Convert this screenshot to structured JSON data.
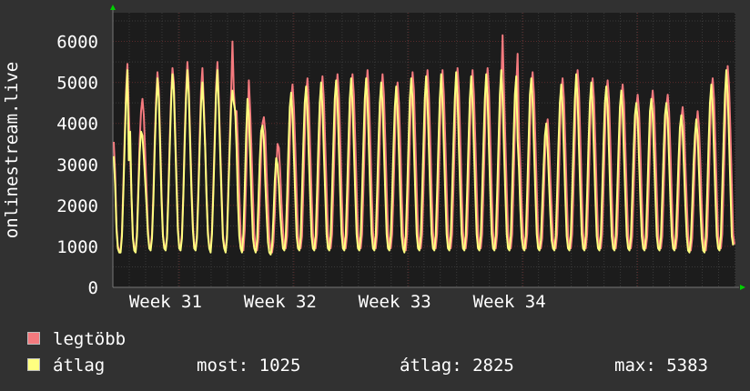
{
  "chart_data": {
    "type": "line",
    "ylabel": "onlinestream.live",
    "ylim": [
      0,
      6700
    ],
    "yticks": [
      0,
      1000,
      2000,
      3000,
      4000,
      5000,
      6000
    ],
    "xlabels": [
      "Week 31",
      "Week 32",
      "Week 33",
      "Week 34"
    ],
    "grid": true,
    "points_per_day": 12,
    "series": [
      {
        "name": "legtöbb",
        "color": "#f47a7e",
        "daily_peaks": [
          5450,
          4600,
          5250,
          5350,
          5500,
          5350,
          5500,
          6000,
          5050,
          4150,
          3500,
          4950,
          5100,
          5150,
          5200,
          5200,
          5300,
          5200,
          5000,
          5250,
          5300,
          5300,
          5350,
          5300,
          5350,
          6150,
          5700,
          5250,
          4100,
          5100,
          5300,
          5100,
          5050,
          4950,
          4700,
          4800,
          4700,
          4400,
          4300,
          5100,
          5400,
          3500
        ],
        "values": [
          3550,
          2800,
          1500,
          1000,
          900,
          900,
          1350,
          2500,
          3700,
          4800,
          5450,
          4300,
          3300,
          2200,
          1250,
          950,
          900,
          1350,
          2500,
          3600,
          4300,
          4600,
          4200,
          3300,
          2400,
          1450,
          1000,
          950,
          1300,
          2300,
          3600,
          4600,
          5250,
          4800,
          3600,
          2300,
          1300,
          1000,
          950,
          1250,
          2400,
          3600,
          4700,
          5350,
          5000,
          3800,
          2700,
          1500,
          1000,
          950,
          1300,
          2300,
          3700,
          4800,
          5500,
          4900,
          3700,
          2500,
          1550,
          1000,
          950,
          1300,
          2400,
          3700,
          4800,
          5350,
          4500,
          3500,
          2300,
          1400,
          1000,
          900,
          1400,
          2500,
          3700,
          4900,
          5500,
          4600,
          3500,
          2400,
          1300,
          1000,
          900,
          1300,
          2500,
          3600,
          4700,
          6000,
          4800,
          4200,
          4300,
          3500,
          2300,
          1300,
          1000,
          900,
          1400,
          2600,
          3900,
          5050,
          4300,
          3300,
          2200,
          1300,
          1000,
          900,
          1200,
          2200,
          3300,
          4000,
          4150,
          3800,
          2800,
          2000,
          1200,
          950,
          850,
          1100,
          1800,
          2800,
          3500,
          3400,
          2800,
          2000,
          1400,
          1000,
          950,
          1250,
          2300,
          3500,
          4600,
          4950,
          4400,
          3400,
          2300,
          1300,
          1000,
          950,
          1250,
          2400,
          3600,
          4700,
          5100,
          4500,
          3400,
          2300,
          1300,
          1000,
          950,
          1300,
          2400,
          3600,
          4700,
          5150,
          4600,
          3500,
          2400,
          1350,
          1000,
          950,
          1300,
          2400,
          3600,
          4700,
          5200,
          4700,
          3600,
          2400,
          1350,
          1000,
          950,
          1300,
          2400,
          3600,
          4800,
          5200,
          4700,
          3600,
          2400,
          1350,
          1000,
          950,
          1300,
          2400,
          3600,
          4800,
          5300,
          4700,
          3600,
          2400,
          1350,
          1000,
          950,
          1300,
          2400,
          3600,
          4700,
          5200,
          4700,
          3600,
          2400,
          1350,
          1000,
          950,
          1300,
          2300,
          3500,
          4600,
          5000,
          4500,
          3500,
          2300,
          1300,
          1000,
          900,
          1300,
          2400,
          3600,
          4700,
          5250,
          4800,
          3600,
          2400,
          1350,
          1000,
          950,
          1300,
          2400,
          3600,
          4800,
          5300,
          4700,
          3600,
          2400,
          1350,
          1000,
          950,
          1300,
          2400,
          3600,
          4800,
          5300,
          4700,
          3600,
          2400,
          1350,
          1000,
          950,
          1300,
          2400,
          3600,
          4800,
          5350,
          4800,
          3600,
          2400,
          1350,
          1000,
          950,
          1300,
          2400,
          3600,
          4800,
          5300,
          4700,
          3600,
          2400,
          1350,
          1000,
          950,
          1300,
          2400,
          3600,
          4800,
          5350,
          4800,
          3600,
          2400,
          1350,
          1000,
          950,
          1300,
          2400,
          3700,
          4900,
          6150,
          4800,
          3600,
          2400,
          1350,
          1000,
          950,
          1300,
          2500,
          3800,
          4900,
          5700,
          3800,
          3000,
          2000,
          1300,
          1000,
          950,
          1300,
          2400,
          3700,
          4900,
          5250,
          4700,
          3600,
          2400,
          1350,
          1000,
          950,
          1200,
          2100,
          3100,
          3800,
          4100,
          3600,
          2700,
          1900,
          1200,
          1000,
          950,
          1300,
          2400,
          3600,
          4700,
          5100,
          4600,
          3500,
          2300,
          1300,
          1000,
          950,
          1300,
          2400,
          3600,
          4800,
          5300,
          4800,
          3600,
          2400,
          1350,
          1000,
          950,
          1300,
          2400,
          3600,
          4700,
          5100,
          4600,
          3500,
          2300,
          1300,
          1000,
          950,
          1300,
          2400,
          3600,
          4700,
          5050,
          4600,
          3500,
          2300,
          1300,
          1000,
          950,
          1300,
          2400,
          3600,
          4600,
          4950,
          4500,
          3400,
          2300,
          1300,
          1000,
          950,
          1250,
          2300,
          3400,
          4400,
          4700,
          4300,
          3300,
          2200,
          1300,
          1000,
          950,
          1250,
          2300,
          3400,
          4400,
          4800,
          4400,
          3400,
          2300,
          1300,
          1000,
          950,
          1250,
          2300,
          3400,
          4400,
          4700,
          4300,
          3300,
          2200,
          1300,
          1000,
          950,
          1250,
          2200,
          3300,
          4100,
          4400,
          4000,
          3000,
          2100,
          1300,
          950,
          900,
          1200,
          2100,
          3100,
          3900,
          4300,
          3900,
          3000,
          2000,
          1250,
          950,
          900,
          1250,
          2400,
          3600,
          4700,
          5100,
          4600,
          3500,
          2300,
          1300,
          1000,
          950,
          1300,
          2500,
          3700,
          4800,
          5400,
          4900,
          3800,
          2500,
          1300,
          1050
        ]
      },
      {
        "name": "átlag",
        "color": "#ffff80",
        "daily_peaks": [
          5300,
          3800,
          5100,
          5200,
          5300,
          5000,
          5300,
          4800,
          4600,
          3950,
          3150,
          4750,
          4900,
          5000,
          5050,
          5100,
          5100,
          5000,
          4900,
          5100,
          5150,
          5200,
          5250,
          5150,
          5200,
          5300,
          5150,
          5100,
          4000,
          4950,
          5200,
          5000,
          4900,
          4800,
          4500,
          4600,
          4500,
          4200,
          4100,
          4950,
          5300,
          3300
        ],
        "values": [
          3200,
          2500,
          1400,
          950,
          850,
          850,
          1250,
          2300,
          3500,
          4600,
          5300,
          3100,
          3800,
          2200,
          1200,
          900,
          850,
          1250,
          2300,
          3300,
          3800,
          3700,
          3200,
          2600,
          2000,
          1300,
          950,
          900,
          1200,
          2100,
          3400,
          4400,
          5100,
          4600,
          3400,
          2100,
          1250,
          950,
          900,
          1200,
          2200,
          3400,
          4500,
          5200,
          4800,
          3600,
          2500,
          1400,
          950,
          900,
          1200,
          2200,
          3500,
          4600,
          5300,
          4700,
          3500,
          2300,
          1400,
          950,
          900,
          1200,
          2200,
          3400,
          4500,
          5000,
          4300,
          3400,
          2200,
          1300,
          950,
          850,
          1300,
          2300,
          3500,
          4700,
          5300,
          4400,
          3300,
          2200,
          1200,
          950,
          850,
          1200,
          2300,
          3400,
          4400,
          4800,
          4500,
          4300,
          3400,
          2100,
          1250,
          950,
          850,
          1300,
          2400,
          3700,
          4600,
          4200,
          3200,
          2100,
          1200,
          950,
          850,
          1100,
          2100,
          3100,
          3800,
          3950,
          3600,
          2600,
          1800,
          1100,
          850,
          800,
          1000,
          1700,
          2600,
          3150,
          3000,
          2500,
          1800,
          1300,
          950,
          900,
          1200,
          2200,
          3400,
          4400,
          4750,
          4200,
          3200,
          2200,
          1250,
          950,
          900,
          1200,
          2300,
          3500,
          4500,
          4900,
          4300,
          3200,
          2200,
          1250,
          950,
          900,
          1250,
          2300,
          3500,
          4500,
          5000,
          4400,
          3300,
          2300,
          1300,
          950,
          900,
          1250,
          2300,
          3500,
          4600,
          5050,
          4500,
          3400,
          2300,
          1300,
          950,
          900,
          1250,
          2300,
          3500,
          4600,
          5100,
          4500,
          3400,
          2300,
          1300,
          950,
          900,
          1250,
          2300,
          3500,
          4600,
          5100,
          4500,
          3400,
          2300,
          1300,
          950,
          900,
          1250,
          2300,
          3500,
          4500,
          5000,
          4500,
          3400,
          2300,
          1300,
          950,
          900,
          1250,
          2200,
          3400,
          4400,
          4900,
          4300,
          3300,
          2200,
          1250,
          950,
          850,
          1250,
          2300,
          3500,
          4600,
          5100,
          4600,
          3400,
          2300,
          1300,
          950,
          900,
          1250,
          2300,
          3500,
          4600,
          5150,
          4500,
          3400,
          2300,
          1300,
          950,
          900,
          1250,
          2300,
          3500,
          4600,
          5200,
          4500,
          3400,
          2300,
          1300,
          950,
          900,
          1250,
          2300,
          3500,
          4600,
          5250,
          4600,
          3400,
          2300,
          1300,
          950,
          900,
          1250,
          2300,
          3500,
          4600,
          5150,
          4500,
          3400,
          2300,
          1300,
          950,
          900,
          1250,
          2300,
          3500,
          4600,
          5200,
          4600,
          3400,
          2300,
          1300,
          950,
          900,
          1250,
          2300,
          3500,
          4700,
          5300,
          4600,
          3400,
          2300,
          1300,
          950,
          900,
          1250,
          2400,
          3600,
          4700,
          5150,
          3600,
          2900,
          1900,
          1200,
          950,
          900,
          1250,
          2300,
          3500,
          4700,
          5100,
          4500,
          3400,
          2300,
          1300,
          950,
          900,
          1150,
          2000,
          2900,
          3700,
          4000,
          3400,
          2600,
          1800,
          1150,
          950,
          900,
          1250,
          2300,
          3500,
          4500,
          4950,
          4400,
          3300,
          2200,
          1250,
          950,
          900,
          1250,
          2300,
          3500,
          4600,
          5200,
          4600,
          3400,
          2300,
          1300,
          950,
          900,
          1250,
          2300,
          3500,
          4500,
          5000,
          4400,
          3300,
          2200,
          1250,
          950,
          900,
          1250,
          2300,
          3500,
          4500,
          4900,
          4400,
          3300,
          2200,
          1250,
          950,
          900,
          1250,
          2300,
          3400,
          4400,
          4800,
          4300,
          3200,
          2200,
          1250,
          950,
          900,
          1200,
          2200,
          3300,
          4200,
          4500,
          4100,
          3100,
          2100,
          1250,
          950,
          900,
          1200,
          2200,
          3300,
          4300,
          4600,
          4200,
          3200,
          2200,
          1250,
          950,
          900,
          1200,
          2200,
          3300,
          4200,
          4500,
          4100,
          3100,
          2100,
          1250,
          950,
          900,
          1200,
          2100,
          3100,
          3900,
          4200,
          3800,
          2900,
          2000,
          1250,
          900,
          850,
          1150,
          2000,
          3000,
          3700,
          4100,
          3700,
          2800,
          1900,
          1200,
          900,
          850,
          1200,
          2300,
          3500,
          4500,
          4950,
          4400,
          3300,
          2200,
          1250,
          950,
          900,
          1250,
          2400,
          3600,
          4700,
          5300,
          4700,
          3600,
          2400,
          1250,
          1025
        ]
      }
    ]
  },
  "legend": {
    "items": [
      {
        "label": "legtöbb",
        "color": "#f47a7e"
      },
      {
        "label": "átlag",
        "color": "#ffff80"
      }
    ]
  },
  "stats": {
    "now_text": "most: 1025",
    "avg_text": "átlag: 2825",
    "max_text": "max: 5383"
  },
  "colors": {
    "background": "#313131",
    "plot_background": "#1c1c1c",
    "grid_minor": "#3a3a3a",
    "grid_major": "#5a2a2a",
    "axis_arrow": "#00d000",
    "text": "#ffffff"
  }
}
